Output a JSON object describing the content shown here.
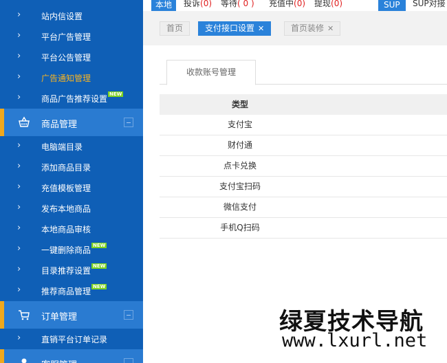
{
  "colors": {
    "sidebar_bg": "#0f5fb6",
    "section_bg": "#2a7bd1",
    "accent": "#f0a81c",
    "primary": "#2a82da",
    "count_red": "#e02020",
    "badge_green": "#7ed321"
  },
  "topbar": {
    "local": "本地",
    "complaint": {
      "label": "投诉",
      "count": "(0)"
    },
    "waiting": {
      "label": "等待",
      "count": "( 0 )"
    },
    "recharging": {
      "label": "充值中",
      "count": "(0)"
    },
    "withdraw": {
      "label": "提现",
      "count": "(0)"
    },
    "sup": "SUP",
    "sup_connect": "SUP对接"
  },
  "sidebar": {
    "items_top": [
      {
        "label": "站内信设置",
        "icon": "chevron-right-icon"
      },
      {
        "label": "平台广告管理",
        "icon": "chevron-right-icon"
      },
      {
        "label": "平台公告管理",
        "icon": "chevron-right-icon"
      },
      {
        "label": "广告通知管理",
        "icon": "chevron-right-icon",
        "active": true
      },
      {
        "label": "商品广告推荐设置",
        "badge": "NEW",
        "icon": "chevron-right-icon"
      }
    ],
    "section_goods": {
      "label": "商品管理",
      "icon": "basket-icon"
    },
    "items_goods": [
      {
        "label": "电脑端目录"
      },
      {
        "label": "添加商品目录"
      },
      {
        "label": "充值模板管理"
      },
      {
        "label": "发布本地商品"
      },
      {
        "label": "本地商品审核"
      },
      {
        "label": "一键删除商品",
        "badge": "NEW"
      },
      {
        "label": "目录推荐设置",
        "badge": "NEW"
      },
      {
        "label": "推荐商品管理",
        "badge": "NEW"
      }
    ],
    "section_orders": {
      "label": "订单管理",
      "icon": "cart-icon"
    },
    "items_orders": [
      {
        "label": "直销平台订单记录"
      }
    ],
    "section_support": {
      "label": "客服管理",
      "icon": "user-icon"
    }
  },
  "page_tabs": [
    {
      "label": "首页"
    },
    {
      "label": "支付接口设置",
      "close": "✕",
      "active": true
    },
    {
      "label": "首页装修",
      "close": "✕"
    }
  ],
  "main": {
    "subtab": "收款账号管理",
    "table": {
      "header": "类型",
      "rows": [
        "支付宝",
        "财付通",
        "点卡兑换",
        "支付宝扫码",
        "微信支付",
        "手机Q扫码"
      ]
    }
  },
  "watermark": {
    "line1": "绿夏技术导航",
    "line2": "www.lxurl.net"
  }
}
